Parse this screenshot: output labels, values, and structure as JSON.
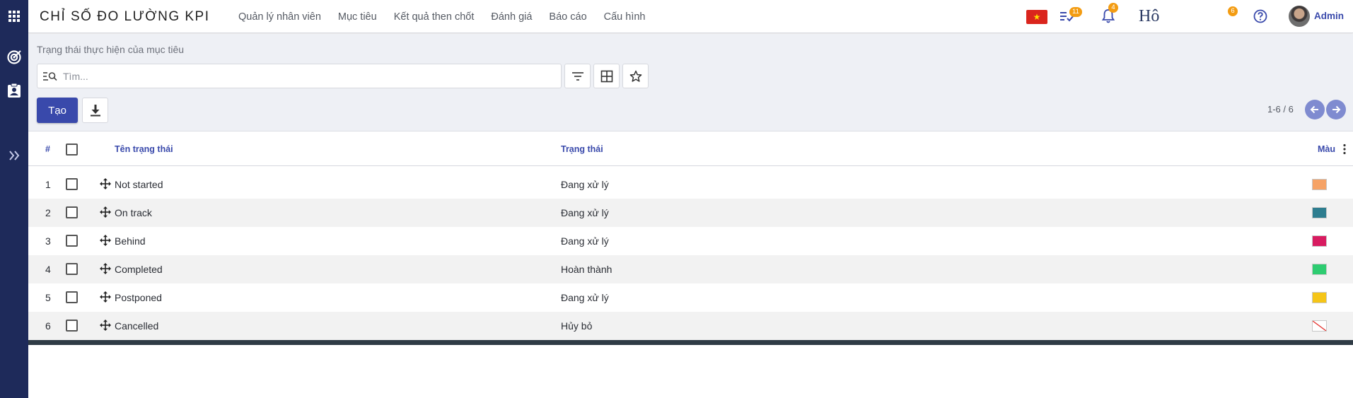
{
  "app": {
    "title": "CHỈ SỐ ĐO LƯỜNG KPI"
  },
  "menu": [
    {
      "label": "Quản lý nhân viên"
    },
    {
      "label": "Mục tiêu"
    },
    {
      "label": "Kết quả then chốt"
    },
    {
      "label": "Đánh giá"
    },
    {
      "label": "Báo cáo"
    },
    {
      "label": "Cấu hình"
    }
  ],
  "topbar": {
    "flag_icon": "vietnam-flag-icon",
    "activity_badge": "11",
    "notification_badge": "4",
    "signature_text": "Hô",
    "chat_badge": "6",
    "user_name": "Admin"
  },
  "breadcrumb": "Trạng thái thực hiện của mục tiêu",
  "search": {
    "placeholder": "Tìm..."
  },
  "actions": {
    "create_label": "Tạo"
  },
  "pager": {
    "text": "1-6 / 6"
  },
  "table": {
    "headers": {
      "index": "#",
      "name": "Tên trạng thái",
      "status": "Trạng thái",
      "color": "Màu"
    },
    "rows": [
      {
        "index": "1",
        "name": "Not started",
        "status": "Đang xử lý",
        "color": "#f6a366"
      },
      {
        "index": "2",
        "name": "On track",
        "status": "Đang xử lý",
        "color": "#2e7d8f"
      },
      {
        "index": "3",
        "name": "Behind",
        "status": "Đang xử lý",
        "color": "#d81b60"
      },
      {
        "index": "4",
        "name": "Completed",
        "status": "Hoàn thành",
        "color": "#2ecc71"
      },
      {
        "index": "5",
        "name": "Postponed",
        "status": "Đang xử lý",
        "color": "#f5c518"
      },
      {
        "index": "6",
        "name": "Cancelled",
        "status": "Hủy bỏ",
        "color": "none"
      }
    ]
  },
  "colors": {
    "primary": "#3949ab",
    "sidebar": "#1e2a5a",
    "badge": "#f39c12"
  }
}
